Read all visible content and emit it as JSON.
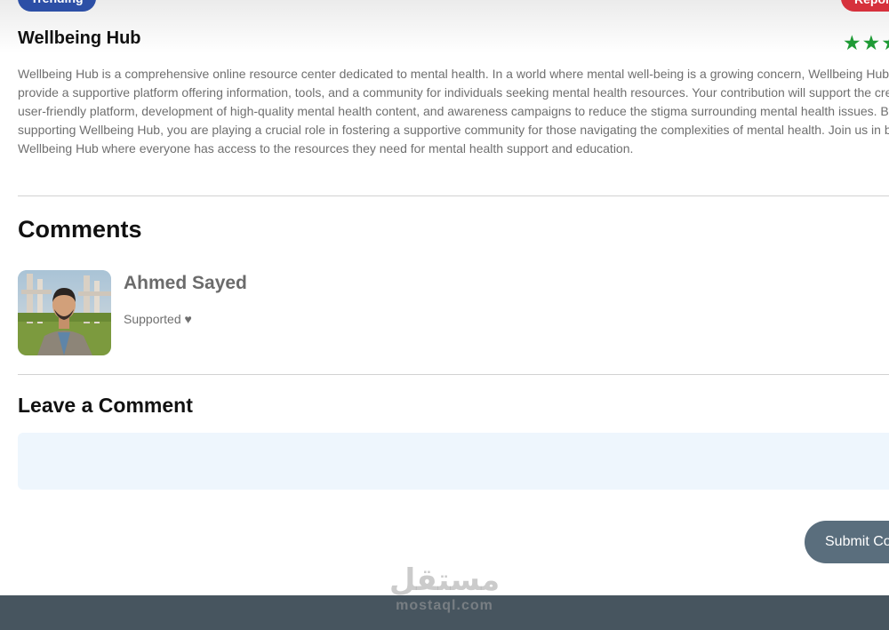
{
  "badges": {
    "trending": "Trending",
    "report": "Report"
  },
  "project": {
    "title": "Wellbeing Hub",
    "rating_stars": "★★★",
    "description_lines": [
      "Wellbeing Hub is a comprehensive online resource center dedicated to mental health. In a world where mental well-being is a growing concern, Wellbeing Hub aims to",
      "provide a supportive platform offering information, tools, and a community for individuals seeking mental health resources. Your contribution will support the creation of a",
      "user-friendly platform, development of high-quality mental health content, and awareness campaigns to reduce the stigma surrounding mental health issues. By",
      "supporting Wellbeing Hub, you are playing a crucial role in fostering a supportive community for those navigating the complexities of mental health. Join us in building",
      "Wellbeing Hub where everyone has access to the resources they need for mental health support and education."
    ]
  },
  "comments": {
    "title": "Comments",
    "items": [
      {
        "name": "Ahmed Sayed",
        "text": "Supported ♥"
      }
    ]
  },
  "leave_comment": {
    "title": "Leave a Comment",
    "value": "",
    "submit_label": "Submit Comment"
  },
  "watermark": {
    "arabic": "مستقل",
    "latin": "mostaql.com"
  },
  "colors": {
    "trending_badge": "#2c4fa6",
    "report_badge": "#d6313c",
    "stars": "#1e9a35",
    "submit_button": "#5a6e7d",
    "comment_box": "#eef6fd",
    "footer": "#47555f"
  }
}
